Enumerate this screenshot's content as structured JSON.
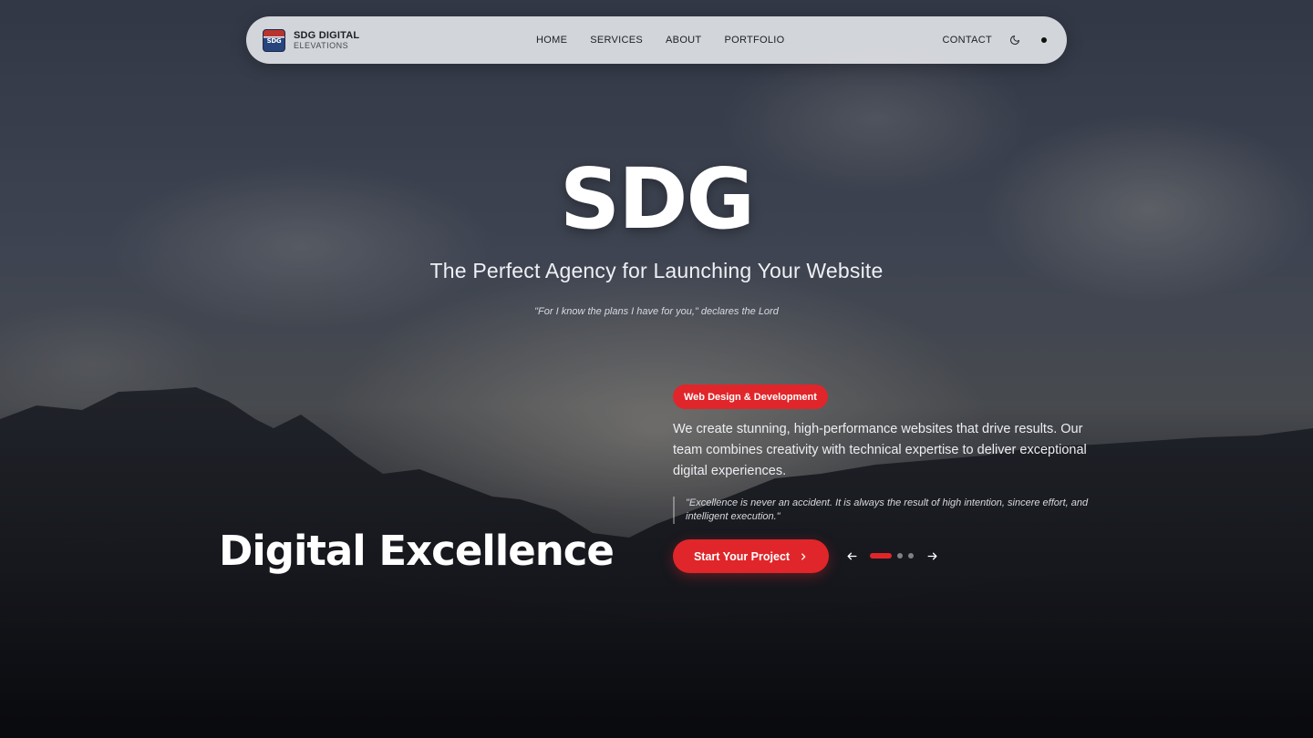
{
  "nav": {
    "brand_name": "SDG DIGITAL",
    "brand_sub": "ELEVATIONS",
    "logo_text": "SDG",
    "links": [
      "HOME",
      "SERVICES",
      "ABOUT",
      "PORTFOLIO"
    ],
    "contact": "CONTACT",
    "theme_toggle_icon": "moon-icon",
    "menu_dot_icon": "dot-icon"
  },
  "hero": {
    "title": "SDG",
    "tagline": "The Perfect Agency for Launching Your Website",
    "verse": "\"For I know the plans I have for you,\" declares the Lord"
  },
  "slide": {
    "heading": "Digital Excellence",
    "badge": "Web Design & Development",
    "description": "We create stunning, high-performance websites that drive results. Our team combines creativity with technical expertise to deliver exceptional digital experiences.",
    "quote": "\"Excellence is never an accident. It is always the result of high intention, sincere effort, and intelligent execution.\"",
    "cta_label": "Start Your Project",
    "carousel": {
      "total": 3,
      "active_index": 0
    }
  },
  "colors": {
    "accent": "#e0262a",
    "nav_bg": "#e8eaee",
    "text": "#ffffff"
  }
}
